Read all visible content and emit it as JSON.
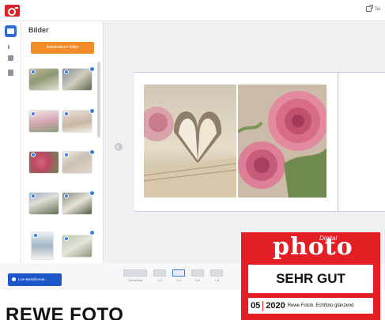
{
  "app": {
    "panel_title": "Bilder",
    "auto_fill_label": "Automatisch füllen",
    "share_label": "Tei",
    "order_button_label": "Live-Bestellende...",
    "page_strip": {
      "labels": [
        "Umschlag",
        "1-2",
        "3-4",
        "5-6",
        "7-8"
      ]
    }
  },
  "thumbnails": [
    {
      "left_subject": "wedding-couple",
      "right_subject": "wedding-couple"
    },
    {
      "left_subject": "bouquet",
      "right_subject": "open-book"
    },
    {
      "left_subject": "roses",
      "right_subject": "wedding-table"
    },
    {
      "left_subject": "wedding-couple",
      "right_subject": "wedding-couple"
    },
    {
      "left_subject": "bride",
      "right_subject": "garden"
    }
  ],
  "canvas": {
    "photos": [
      {
        "subject": "open-book-with-heart-folded-pages"
      },
      {
        "subject": "pink-roses"
      }
    ]
  },
  "article": {
    "headline": "REWE FOTO"
  },
  "seal": {
    "digital_label": "Digital",
    "brand": "photo",
    "rating": "SEHR GUT",
    "issue": "05",
    "year": "2020",
    "product": "Rewe Fotob. Echtfoto glänzend",
    "brand_color": "#e31e24"
  },
  "colors": {
    "accent_blue": "#2f6fd3",
    "auto_fill_orange": "#f28c28",
    "logo_red": "#d8232a"
  }
}
